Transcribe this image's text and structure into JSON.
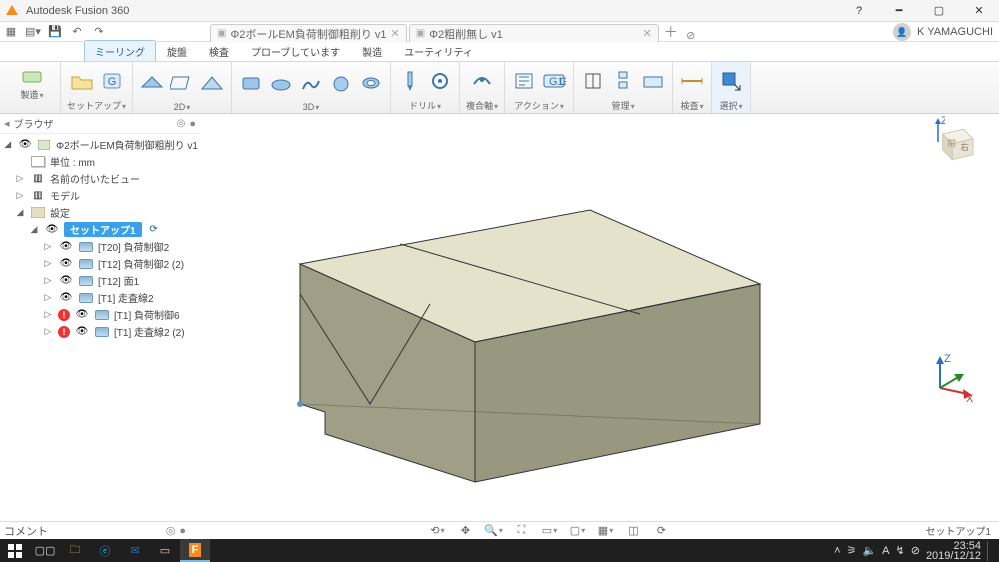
{
  "app": {
    "title": "Autodesk Fusion 360"
  },
  "docTabs": [
    {
      "label": "Φ2ボールEM負荷制御粗削り v1",
      "active": true
    },
    {
      "label": "Φ2粗削無し v1",
      "active": false
    }
  ],
  "user": {
    "name": "K YAMAGUCHI"
  },
  "qat": {
    "undo": "↶",
    "redo": "↷"
  },
  "workspaceMenu": {
    "label": "製造"
  },
  "workspaceTabs": [
    "ミーリング",
    "旋盤",
    "検査",
    "プローブしています",
    "製造",
    "ユーティリティ"
  ],
  "activeWorkspaceTab": 0,
  "ribbon": {
    "setup": "セットアップ",
    "twoD": "2D",
    "threeD": "3D",
    "drill": "ドリル",
    "multiAxis": "複合軸",
    "action": "アクション",
    "manage": "管理",
    "inspect": "検査",
    "select": "選択"
  },
  "browser": {
    "title": "ブラウザ",
    "root": "Φ2ボールEM負荷制御粗削り v1",
    "units": "単位 : mm",
    "namedViews": "名前の付いたビュー",
    "model": "モデル",
    "settings": "設定",
    "setup": "セットアップ1",
    "ops": [
      {
        "label": "[T20] 負荷制御2",
        "err": false
      },
      {
        "label": "[T12] 負荷制御2 (2)",
        "err": false
      },
      {
        "label": "[T12] 面1",
        "err": false
      },
      {
        "label": "[T1] 走査線2",
        "err": false
      },
      {
        "label": "[T1] 負荷制御6",
        "err": true
      },
      {
        "label": "[T1] 走査線2 (2)",
        "err": true
      }
    ]
  },
  "comments": {
    "label": "コメント"
  },
  "status": {
    "right": "セットアップ1"
  },
  "viewcube": {
    "front": "前",
    "right": "右"
  },
  "taskbar": {
    "time": "23:54",
    "date": "2019/12/12"
  }
}
